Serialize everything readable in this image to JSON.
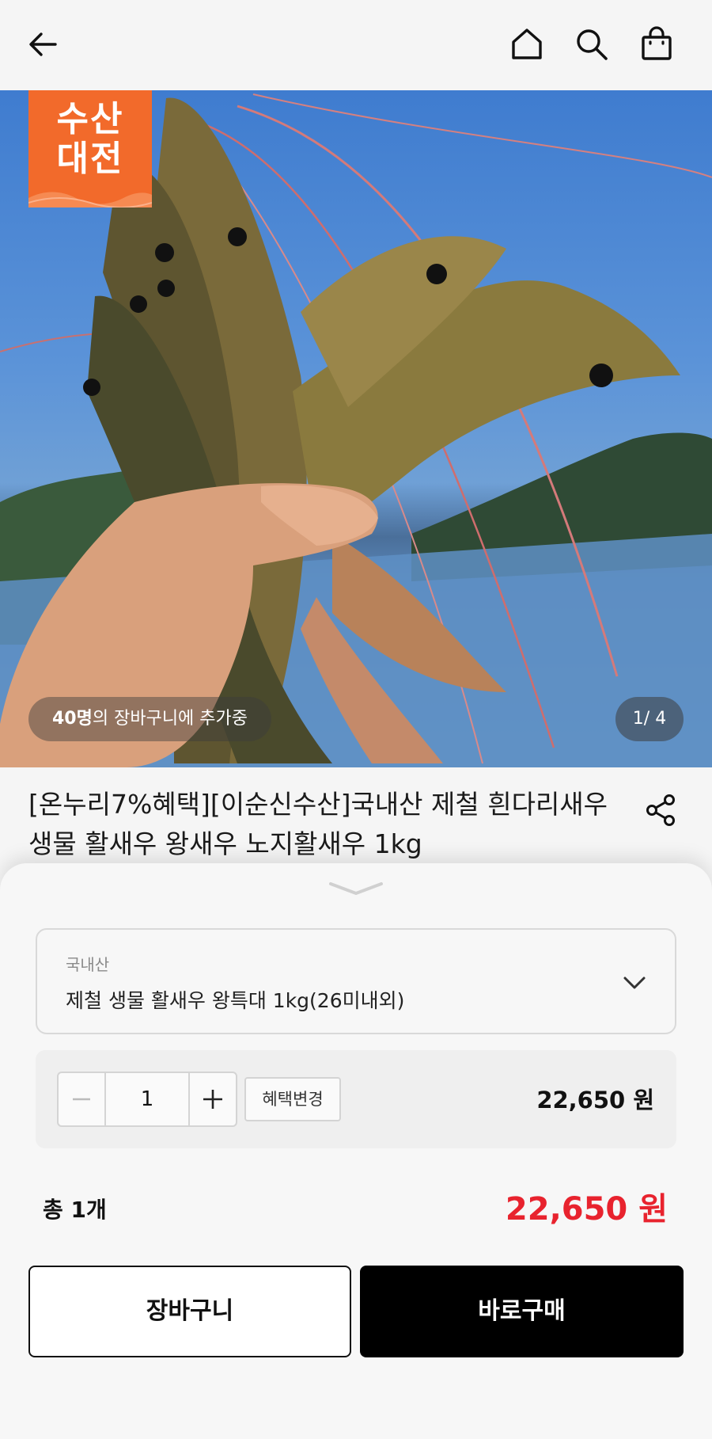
{
  "header": {
    "back_icon": "arrow-left-icon",
    "home_icon": "home-icon",
    "search_icon": "search-icon",
    "cart_icon": "shopping-bag-icon"
  },
  "hero": {
    "badge_line1": "수산",
    "badge_line2": "대전",
    "cart_count_strong": "40명",
    "cart_count_rest": "의 장바구니에 추가중",
    "pager": "1/ 4",
    "badge_color": "#f26a2b"
  },
  "product": {
    "title": "[온누리7%혜택][이순신수산]국내산 제철 흰다리새우 생물 활새우 왕새우 노지활새우 1kg",
    "share_icon": "share-icon"
  },
  "option": {
    "label": "국내산",
    "value": "제철 생물 활새우 왕특대 1kg(26미내외)"
  },
  "quantity": {
    "value": "1",
    "benefit_label": "혜택변경",
    "line_price": "22,650 원"
  },
  "total": {
    "label": "총 1개",
    "price": "22,650 원",
    "price_color": "#e8232e"
  },
  "actions": {
    "cart_label": "장바구니",
    "buy_label": "바로구매"
  }
}
